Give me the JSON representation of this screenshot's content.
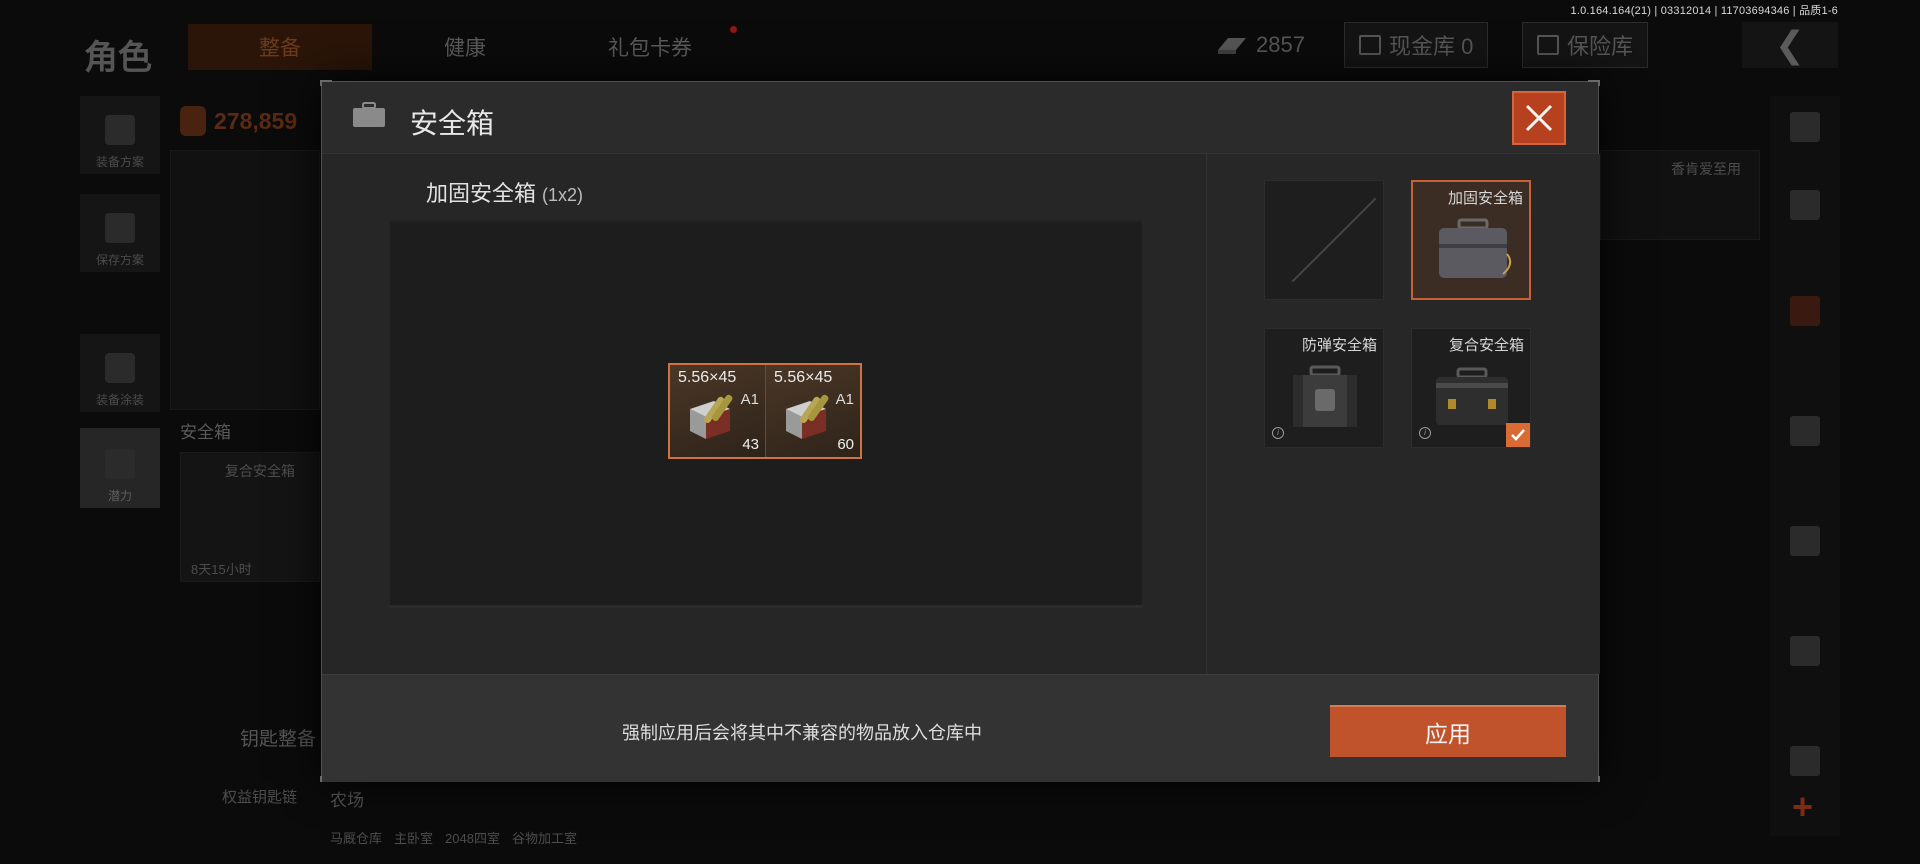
{
  "version": "1.0.164.164(21) | 03312014 | 11703694346 | 品质1-6",
  "background": {
    "page_title": "角色",
    "tabs": [
      {
        "label": "整备",
        "active": true
      },
      {
        "label": "健康",
        "active": false
      },
      {
        "label": "礼包卡券",
        "active": false
      }
    ],
    "currency_value": "2857",
    "cash_vault_label": "现金库 0",
    "insurance_label": "保险库",
    "money": "278,859",
    "left_buttons": [
      {
        "label": "装备方案"
      },
      {
        "label": "保存方案"
      },
      {
        "label": "装备涂装"
      },
      {
        "label": "潜力"
      }
    ],
    "safebox_section_label": "安全箱",
    "safebox_card_name": "复合安全箱",
    "safebox_timer": "8天15小时",
    "key_section_label": "钥匙整备",
    "key_item_label": "权益钥匙链",
    "farm_label": "农场",
    "farm_rows": [
      "马厩仓库",
      "主卧室",
      "2048四室",
      "谷物加工室"
    ],
    "right_top_label": "香肯爱至用"
  },
  "modal": {
    "title": "安全箱",
    "case_name": "加固安全箱",
    "case_size": "(1x2)",
    "items": [
      {
        "name": "5.56×45",
        "variant": "A1",
        "count": "43"
      },
      {
        "name": "5.56×45",
        "variant": "A1",
        "count": "60"
      }
    ],
    "slots": [
      {
        "label": "",
        "empty": true,
        "selected": false,
        "equipped": false
      },
      {
        "label": "加固安全箱",
        "empty": false,
        "selected": true,
        "equipped": false
      },
      {
        "label": "防弹安全箱",
        "empty": false,
        "selected": false,
        "equipped": false
      },
      {
        "label": "复合安全箱",
        "empty": false,
        "selected": false,
        "equipped": true
      }
    ],
    "footer_note": "强制应用后会将其中不兼容的物品放入仓库中",
    "apply_label": "应用"
  },
  "colors": {
    "accent": "#c0532c",
    "selected_border": "#c66236",
    "modal_bg": "#262626"
  }
}
